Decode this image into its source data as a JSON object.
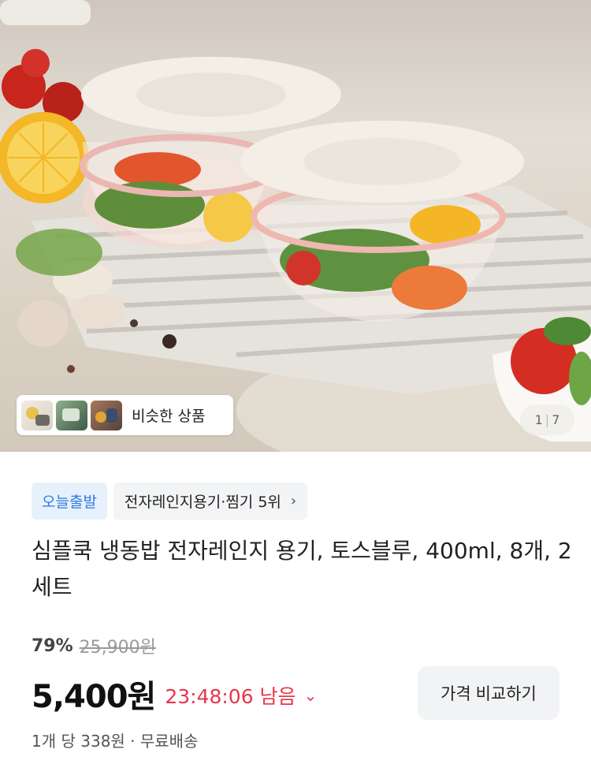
{
  "hero": {
    "similar_label": "비슷한 상품",
    "page_current": "1",
    "page_total": "7"
  },
  "badges": {
    "delivery": "오늘출발",
    "rank": "전자레인지용기·찜기 5위",
    "rank_chevron": "›"
  },
  "product": {
    "title": "심플쿡 냉동밥 전자레인지 용기, 토스블루, 400ml, 8개, 2세트",
    "discount": "79%",
    "original_price": "25,900원",
    "price": "5,400원",
    "countdown": "23:48:06 남음",
    "countdown_chevron": "⌄",
    "compare_button": "가격 비교하기",
    "unit_info": "1개 당 338원 · 무료배송"
  },
  "colors": {
    "delivery_badge_text": "#2f7be0",
    "countdown": "#e8354a"
  }
}
